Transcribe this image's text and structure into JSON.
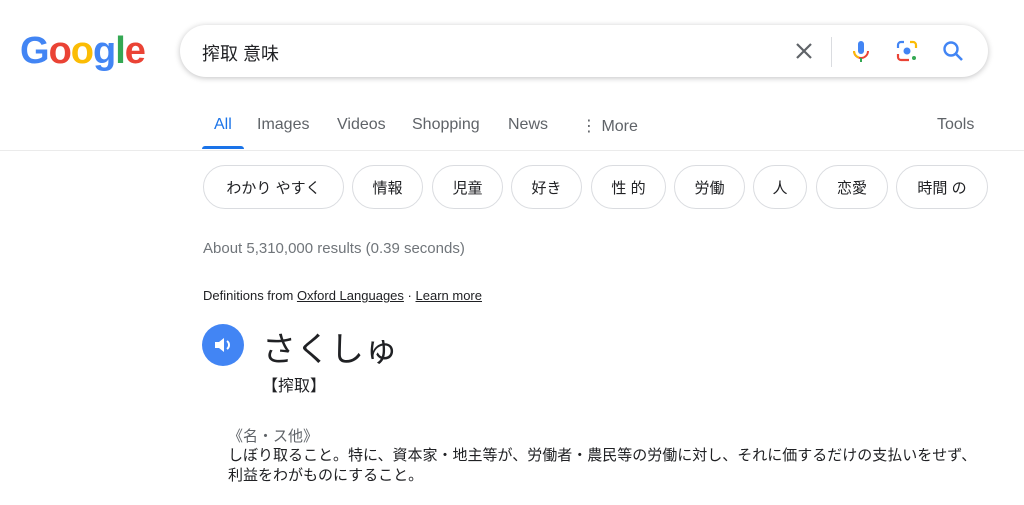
{
  "logo": "Google",
  "search": {
    "query": "搾取 意味"
  },
  "tabs": [
    {
      "label": "All",
      "active": true
    },
    {
      "label": "Images"
    },
    {
      "label": "Videos"
    },
    {
      "label": "Shopping"
    },
    {
      "label": "News"
    },
    {
      "label": "More"
    }
  ],
  "tools_label": "Tools",
  "chips": [
    "わかり やすく",
    "情報",
    "児童",
    "好き",
    "性 的",
    "労働",
    "人",
    "恋愛",
    "時間 の"
  ],
  "result_stats": "About 5,310,000 results (0.39 seconds)",
  "definitions": {
    "prefix": "Definitions from",
    "source": "Oxford Languages",
    "sep": "·",
    "learn_more": "Learn more"
  },
  "entry": {
    "reading": "さくしゅ",
    "kanji": "【搾取】",
    "part_of_speech": "《名・ス他》",
    "definition": "しぼり取ること。特に、資本家・地主等が、労働者・農民等の労働に対し、それに価するだけの支払いをせず、利益をわがものにすること。"
  },
  "colors": {
    "accent": "#1a73e8",
    "speaker": "#4285f4"
  }
}
